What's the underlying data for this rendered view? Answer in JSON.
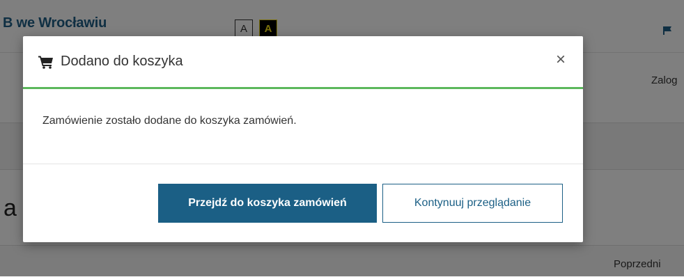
{
  "page": {
    "site_title": "B we Wrocławiu",
    "contrast_normal_label": "A",
    "contrast_high_label": "A",
    "login_label": "Zalog",
    "heading_fragment": "a",
    "previous_label": "Poprzedni"
  },
  "modal": {
    "title": "Dodano do koszyka",
    "close_symbol": "×",
    "message": "Zamówienie zostało dodane do koszyka zamówień.",
    "primary_button": "Przejdź do koszyka zamówień",
    "secondary_button": "Kontynuuj przeglądanie",
    "icons": {
      "header": "cart-icon",
      "close": "close-icon"
    }
  },
  "colors": {
    "accent": "#1b5f85",
    "success_line": "#5cb85c",
    "overlay": "rgba(0,0,0,0.5)"
  }
}
